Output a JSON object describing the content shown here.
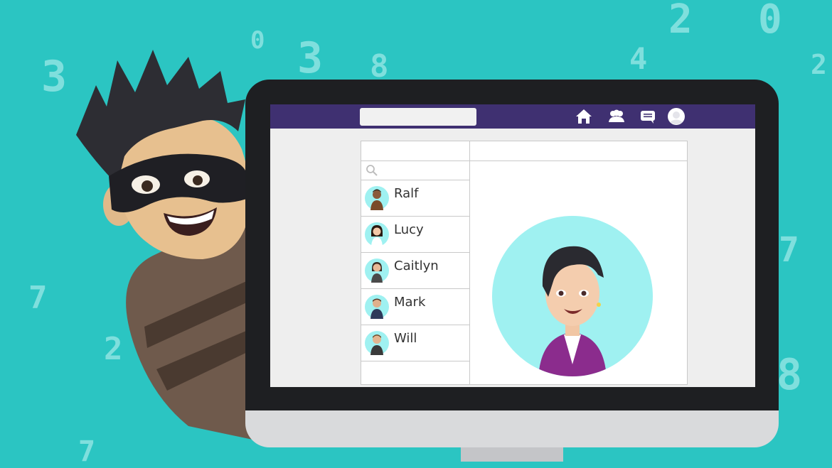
{
  "background_digits": [
    {
      "text": "3",
      "id": "d1"
    },
    {
      "text": "0",
      "id": "d2"
    },
    {
      "text": "3",
      "id": "d3"
    },
    {
      "text": "8",
      "id": "d4"
    },
    {
      "text": "4",
      "id": "d5"
    },
    {
      "text": "2",
      "id": "d6"
    },
    {
      "text": "0",
      "id": "d7"
    },
    {
      "text": "2",
      "id": "d8"
    },
    {
      "text": "7",
      "id": "d9"
    },
    {
      "text": "2",
      "id": "d10"
    },
    {
      "text": "7",
      "id": "d11"
    },
    {
      "text": "8",
      "id": "d12"
    },
    {
      "text": "7",
      "id": "d13"
    }
  ],
  "app": {
    "nav_icons": [
      "home-icon",
      "group-icon",
      "chat-icon",
      "profile-icon"
    ],
    "contacts": [
      {
        "name": "Ralf"
      },
      {
        "name": "Lucy"
      },
      {
        "name": "Caitlyn"
      },
      {
        "name": "Mark"
      },
      {
        "name": "Will"
      }
    ]
  },
  "colors": {
    "background": "#2bc5c2",
    "topbar": "#3f3071",
    "avatar_bg": "#9ff1f1",
    "blouse": "#8b2c8d"
  }
}
